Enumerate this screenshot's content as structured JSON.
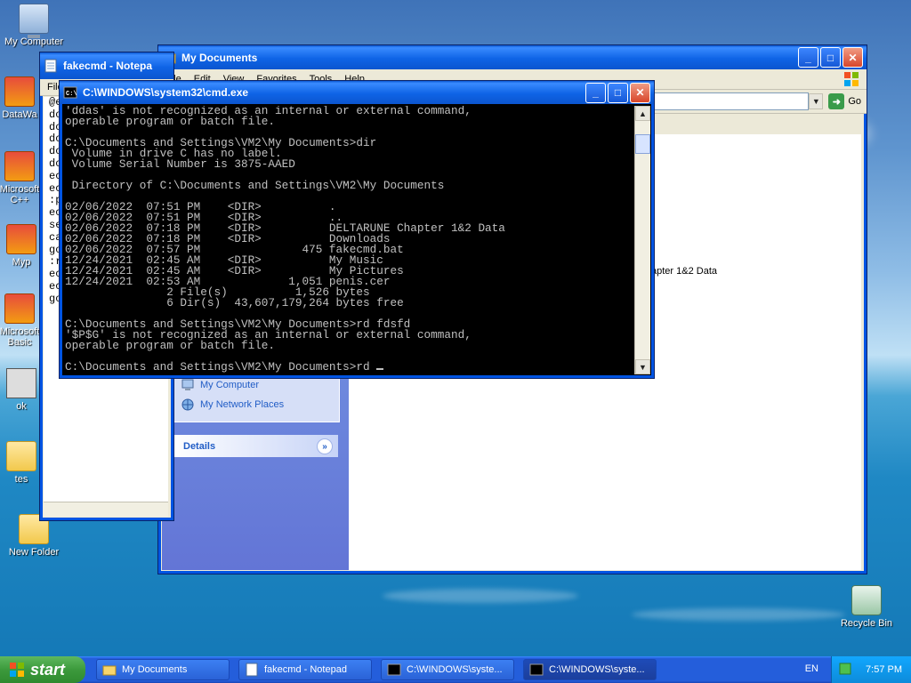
{
  "desktop": {
    "icons": [
      {
        "label": "My Computer"
      },
      {
        "label": "DataWa"
      },
      {
        "label": "Microsoft C++"
      },
      {
        "label": "Myp"
      },
      {
        "label": "Microsoft Basic"
      },
      {
        "label": "ok"
      },
      {
        "label": "tes"
      },
      {
        "label": "New Folder"
      },
      {
        "label": "Recycle Bin"
      }
    ]
  },
  "mydocs": {
    "title": "My Documents",
    "menu": [
      "File",
      "Edit",
      "View",
      "Favorites",
      "Tools",
      "Help"
    ],
    "go_label": "Go",
    "right_text": "apter 1&2 Data",
    "other_places": [
      "My Computer",
      "My Network Places"
    ],
    "details_label": "Details"
  },
  "notepad": {
    "title": "fakecmd - Notepa",
    "menu_label": "File",
    "lines": [
      "@e",
      "do",
      "do",
      "do",
      "do",
      "do",
      "ec",
      "ec",
      ":p",
      "ec",
      "se",
      "ca",
      "go",
      ":r",
      "ec",
      "ec",
      "go"
    ]
  },
  "cmd": {
    "title": "C:\\WINDOWS\\system32\\cmd.exe",
    "lines": [
      "'ddas' is not recognized as an internal or external command,",
      "operable program or batch file.",
      "",
      "C:\\Documents and Settings\\VM2\\My Documents>dir",
      " Volume in drive C has no label.",
      " Volume Serial Number is 3875-AAED",
      "",
      " Directory of C:\\Documents and Settings\\VM2\\My Documents",
      "",
      "02/06/2022  07:51 PM    <DIR>          .",
      "02/06/2022  07:51 PM    <DIR>          ..",
      "02/06/2022  07:18 PM    <DIR>          DELTARUNE Chapter 1&2 Data",
      "02/06/2022  07:18 PM    <DIR>          Downloads",
      "02/06/2022  07:57 PM               475 fakecmd.bat",
      "12/24/2021  02:45 AM    <DIR>          My Music",
      "12/24/2021  02:45 AM    <DIR>          My Pictures",
      "12/24/2021  02:53 AM             1,051 penis.cer",
      "               2 File(s)          1,526 bytes",
      "               6 Dir(s)  43,607,179,264 bytes free",
      "",
      "C:\\Documents and Settings\\VM2\\My Documents>rd fdsfd",
      "'$P$G' is not recognized as an internal or external command,",
      "operable program or batch file.",
      "",
      "C:\\Documents and Settings\\VM2\\My Documents>rd "
    ]
  },
  "taskbar": {
    "start_label": "start",
    "buttons": [
      {
        "label": "My Documents"
      },
      {
        "label": "fakecmd - Notepad"
      },
      {
        "label": "C:\\WINDOWS\\syste..."
      },
      {
        "label": "C:\\WINDOWS\\syste..."
      }
    ],
    "lang": "EN",
    "clock": "7:57 PM"
  },
  "colors": {
    "xp_blue": "#0054e3",
    "start_green": "#3c9a3c",
    "cmd_text": "#c0c0c0"
  }
}
